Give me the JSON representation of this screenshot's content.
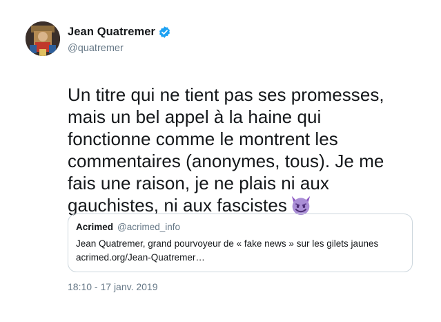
{
  "author": {
    "display_name": "Jean Quatremer",
    "handle": "@quatremer"
  },
  "tweet": {
    "lines": [
      "Un titre qui ne tient pas ses promesses,",
      "mais un bel appel à la haine qui",
      "fonctionne comme le montrent les",
      "commentaires (anonymes, tous). Je me",
      "fais une raison, je ne plais ni aux",
      "gauchistes, ni aux fascistes"
    ],
    "emoji": "smiling-imp",
    "timestamp": "18:10 - 17 janv. 2019"
  },
  "quoted": {
    "display_name": "Acrimed",
    "handle": "@acrimed_info",
    "text_line1": "Jean Quatremer, grand pourvoyeur de « fake news » sur les gilets jaunes",
    "text_line2": "acrimed.org/Jean-Quatremer…"
  },
  "colors": {
    "verified_badge": "#1da1f2",
    "secondary_text": "#657786",
    "border": "#ccd6dd",
    "emoji_purple": "#8d59c3"
  }
}
